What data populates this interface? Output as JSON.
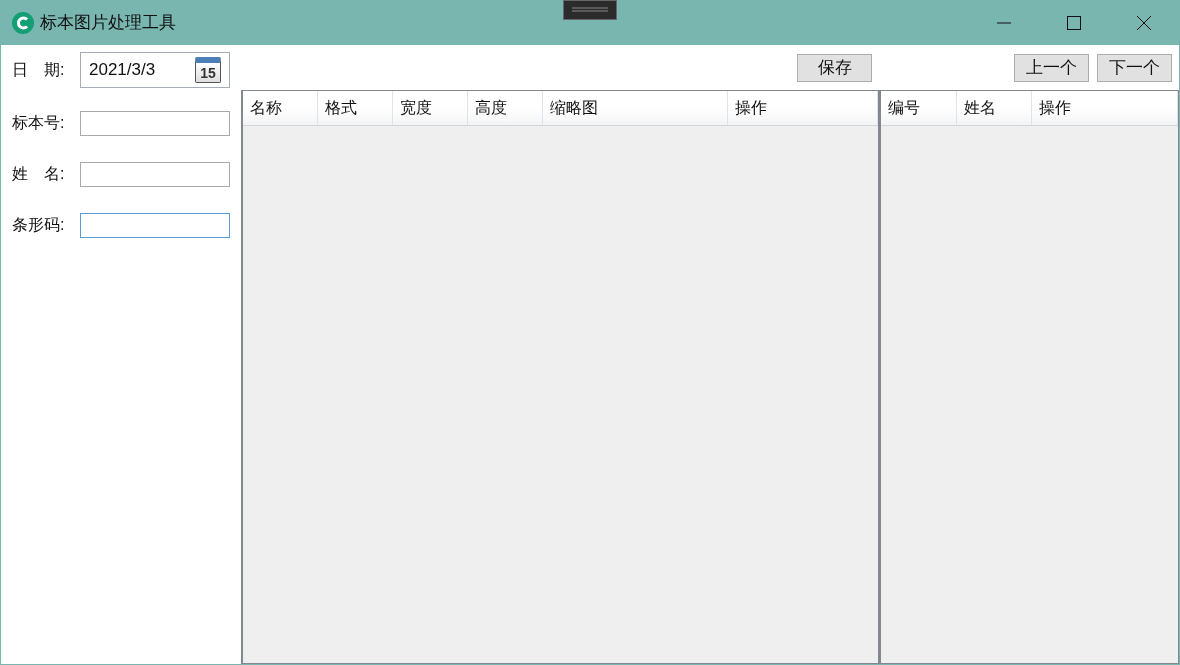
{
  "window": {
    "title": "标本图片处理工具"
  },
  "form": {
    "fields": [
      {
        "label": "日　期:",
        "kind": "date",
        "value": "2021/3/3",
        "calendar_day": "15",
        "focused": false
      },
      {
        "label": "标本号:",
        "kind": "text",
        "focused": false
      },
      {
        "label": "姓　名:",
        "kind": "text",
        "focused": false
      },
      {
        "label": "条形码:",
        "kind": "text",
        "focused": true
      }
    ]
  },
  "toolbar": {
    "save_button": "保存",
    "nav_buttons": [
      "上一个",
      "下一个"
    ]
  },
  "image_table": {
    "columns": [
      "名称",
      "格式",
      "宽度",
      "高度",
      "缩略图",
      "操作"
    ]
  },
  "person_table": {
    "columns": [
      "编号",
      "姓名",
      "操作"
    ]
  }
}
